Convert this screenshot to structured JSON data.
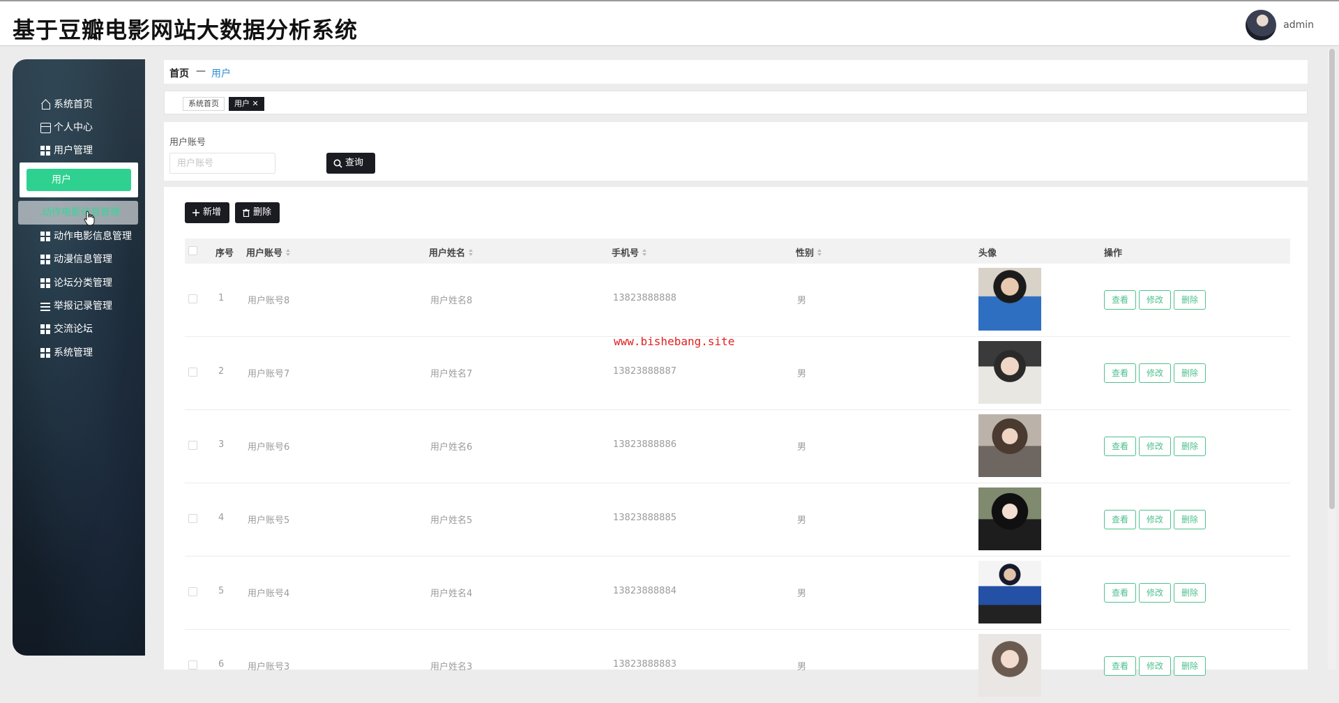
{
  "header": {
    "title": "基于豆瓣电影网站大数据分析系统",
    "username": "admin"
  },
  "sidebar": {
    "items": [
      {
        "label": "系统首页",
        "icon": "home-icon"
      },
      {
        "label": "个人中心",
        "icon": "card-icon"
      },
      {
        "label": "用户管理",
        "icon": "grid-icon"
      },
      {
        "label": "动作电影信息管理",
        "icon": "grid-icon"
      },
      {
        "label": "动漫信息管理",
        "icon": "grid-icon"
      },
      {
        "label": "论坛分类管理",
        "icon": "grid-icon"
      },
      {
        "label": "举报记录管理",
        "icon": "list-icon"
      },
      {
        "label": "交流论坛",
        "icon": "grid-icon"
      },
      {
        "label": "系统管理",
        "icon": "grid-icon"
      }
    ],
    "active_sub": "用户",
    "hover_sub": "动作电影信息管理"
  },
  "breadcrumb": {
    "home": "首页",
    "sep": "—",
    "current": "用户"
  },
  "tabs": [
    {
      "label": "系统首页"
    },
    {
      "label": "用户 ✕"
    }
  ],
  "search": {
    "label": "用户账号",
    "placeholder": "用户账号",
    "button": "查询"
  },
  "actions": {
    "add": "新增",
    "delete": "删除"
  },
  "table": {
    "columns": [
      "序号",
      "用户账号",
      "用户姓名",
      "手机号",
      "性别",
      "头像",
      "操作"
    ],
    "rows": [
      {
        "idx": "1",
        "account": "用户账号8",
        "name": "用户姓名8",
        "phone": "13823888888",
        "gender": "男"
      },
      {
        "idx": "2",
        "account": "用户账号7",
        "name": "用户姓名7",
        "phone": "13823888887",
        "gender": "男"
      },
      {
        "idx": "3",
        "account": "用户账号6",
        "name": "用户姓名6",
        "phone": "13823888886",
        "gender": "男"
      },
      {
        "idx": "4",
        "account": "用户账号5",
        "name": "用户姓名5",
        "phone": "13823888885",
        "gender": "男"
      },
      {
        "idx": "5",
        "account": "用户账号4",
        "name": "用户姓名4",
        "phone": "13823888884",
        "gender": "男"
      },
      {
        "idx": "6",
        "account": "用户账号3",
        "name": "用户姓名3",
        "phone": "13823888883",
        "gender": "男"
      }
    ],
    "row_actions": {
      "view": "查看",
      "edit": "修改",
      "delete": "删除"
    }
  },
  "watermark": "www.bishebang.site",
  "colors": {
    "accent": "#2fd191",
    "dark": "#1b1b22",
    "link": "#2f8fd0",
    "watermark": "#e02020"
  }
}
